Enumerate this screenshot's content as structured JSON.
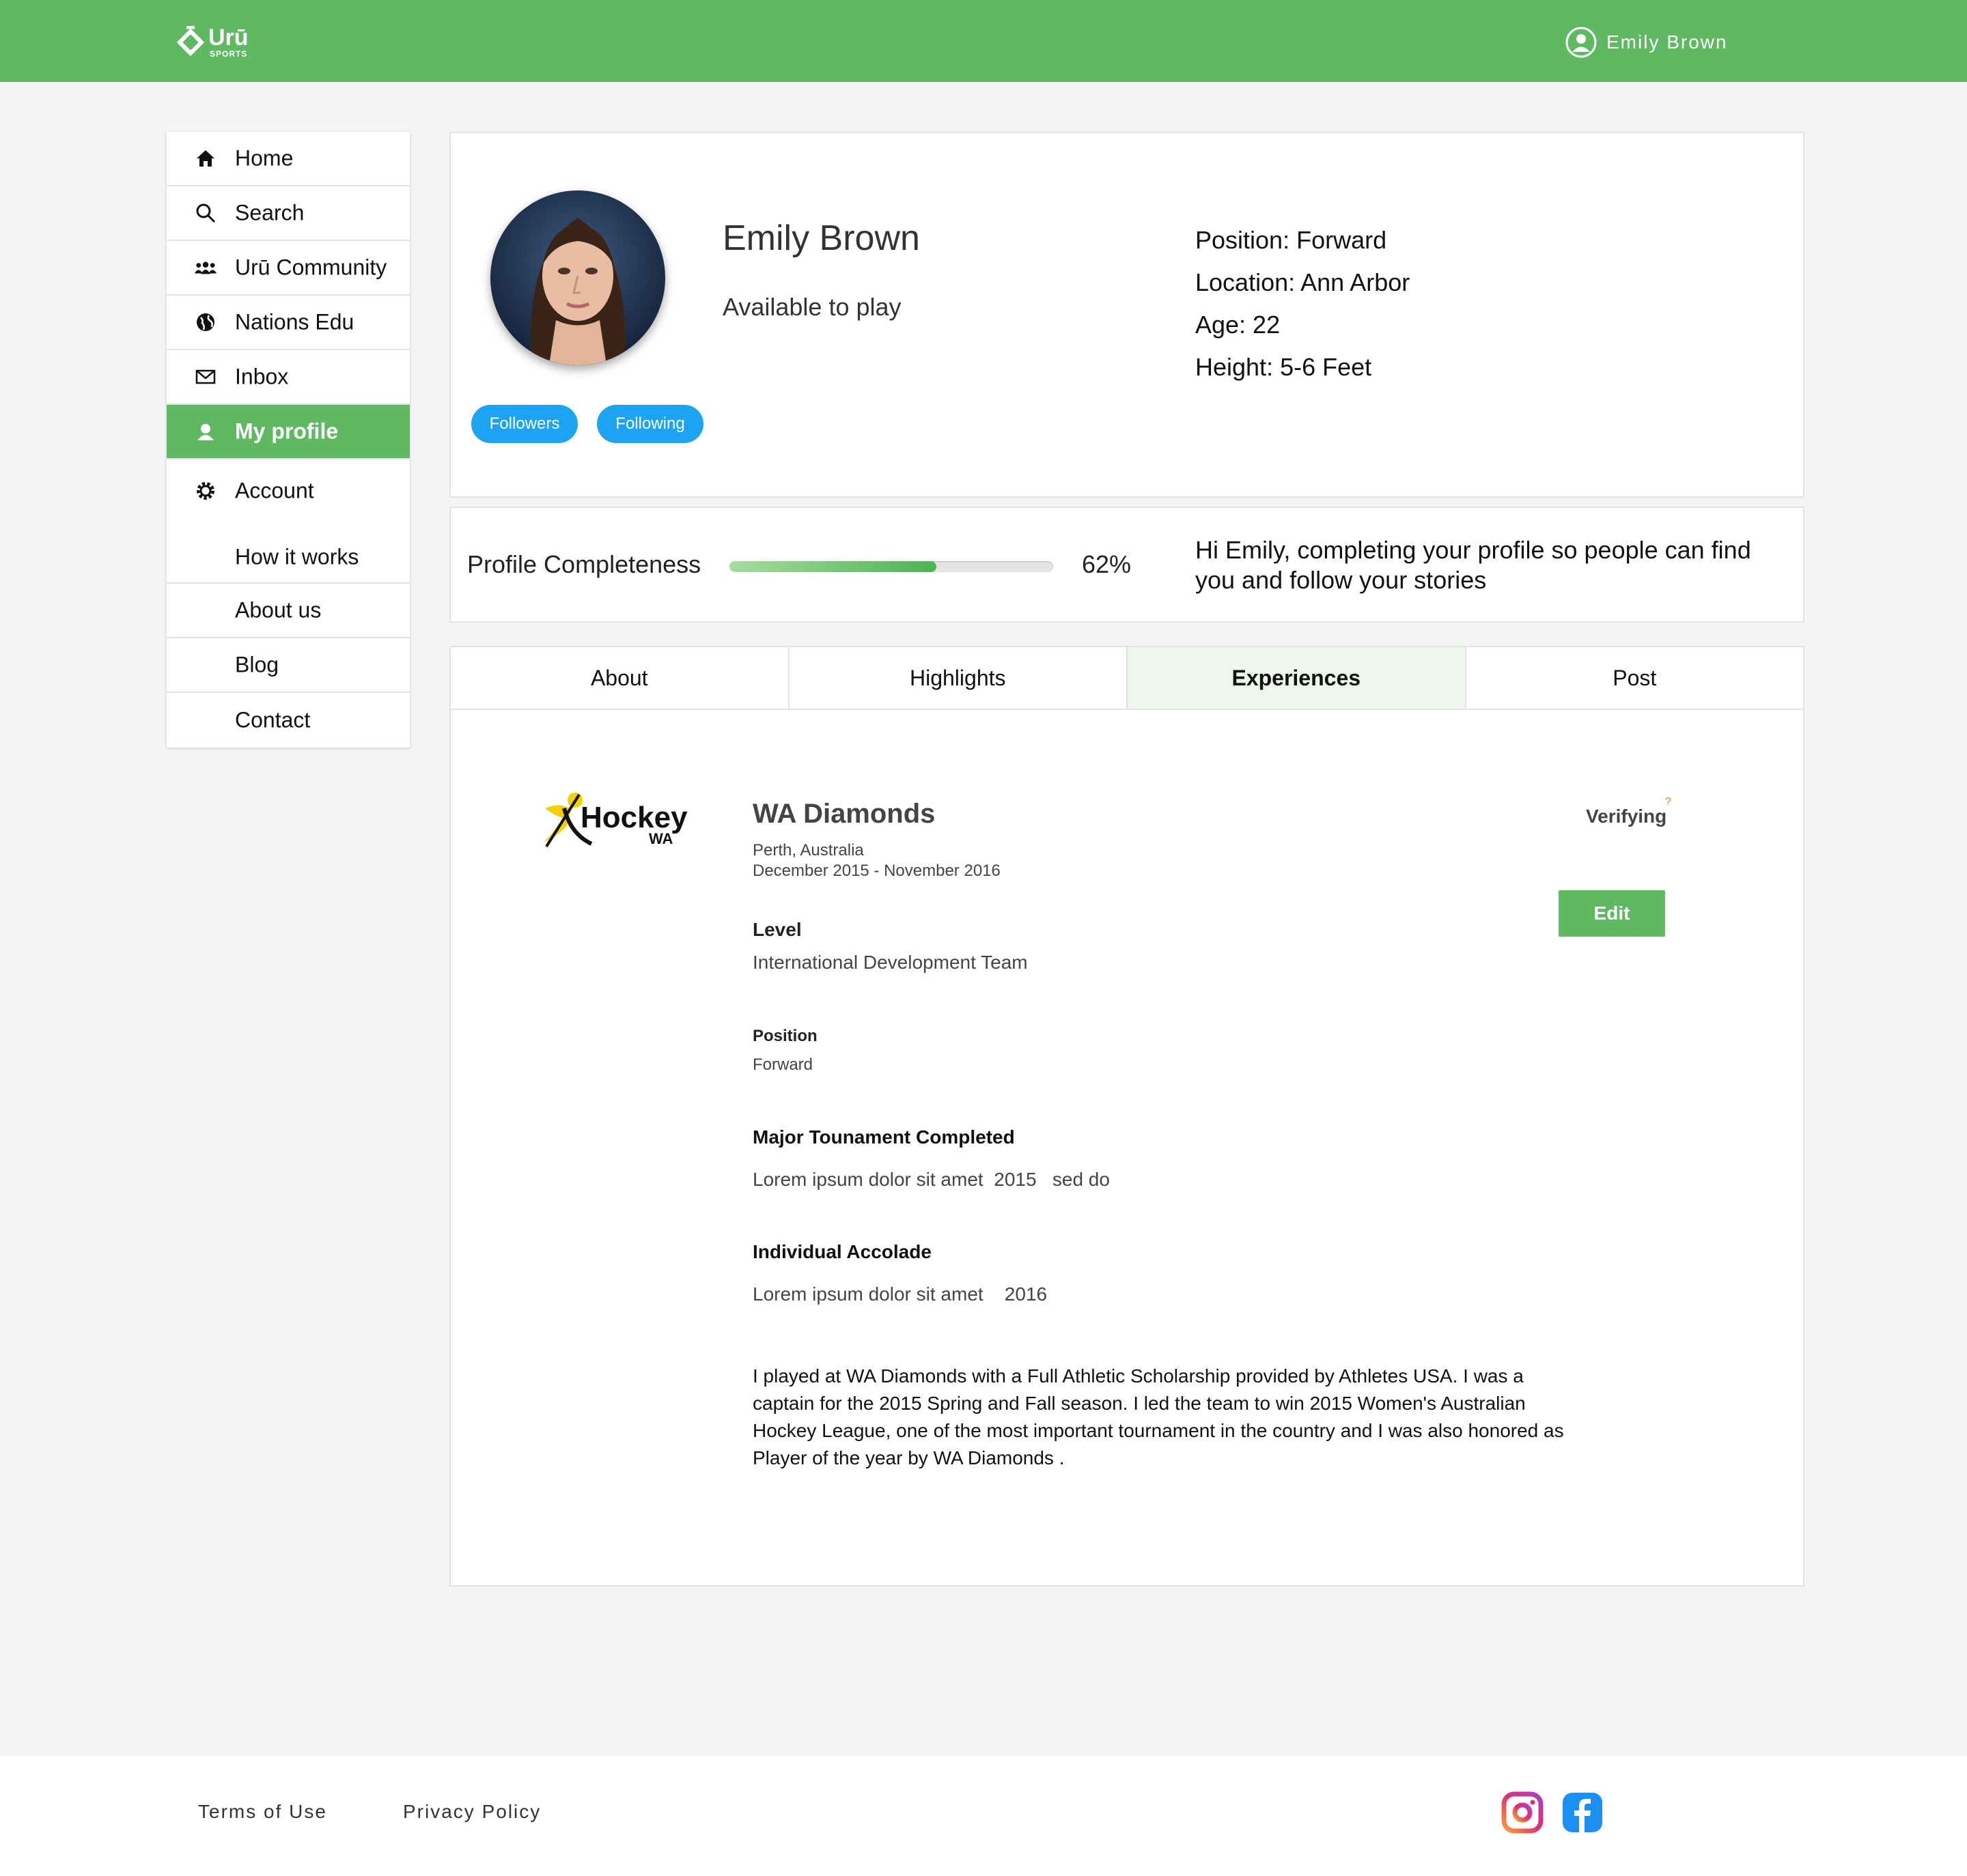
{
  "header": {
    "logo_text": "Urū",
    "logo_sub": "SPORTS",
    "user_name": "Emily Brown"
  },
  "sidebar": {
    "items": [
      {
        "label": "Home",
        "icon": "home-icon"
      },
      {
        "label": "Search",
        "icon": "search-icon"
      },
      {
        "label": "Urū Community",
        "icon": "community-icon"
      },
      {
        "label": "Nations Edu",
        "icon": "globe-icon"
      },
      {
        "label": "Inbox",
        "icon": "mail-icon"
      },
      {
        "label": "My profile",
        "icon": "user-icon",
        "active": true
      },
      {
        "label": "Account",
        "icon": "gear-icon"
      },
      {
        "label": "How it works"
      },
      {
        "label": "About us"
      },
      {
        "label": "Blog"
      },
      {
        "label": "Contact"
      }
    ]
  },
  "profile": {
    "name": "Emily Brown",
    "status": "Available to play",
    "followers_label": "Followers",
    "following_label": "Following",
    "position": "Position: Forward",
    "location": "Location: Ann Arbor",
    "age": "Age: 22",
    "height": "Height: 5-6 Feet"
  },
  "completeness": {
    "label": "Profile Completeness",
    "percent_text": "62%",
    "bar_fraction": 0.64,
    "message": "Hi Emily, completing your profile so people can find you and follow your stories"
  },
  "tabs": [
    {
      "label": "About"
    },
    {
      "label": "Highlights"
    },
    {
      "label": "Experiences",
      "active": true
    },
    {
      "label": "Post"
    }
  ],
  "experience": {
    "logo_text": "Hockey",
    "logo_sub": "WA",
    "team": "WA Diamonds",
    "location": "Perth, Australia",
    "dates": "December 2015 - November 2016",
    "verify_status": "Verifying",
    "verify_mark": "?",
    "edit_label": "Edit",
    "level_label": "Level",
    "level_value": "International Development Team",
    "position_label": "Position",
    "position_value": "Forward",
    "tournament_label": "Major Tounament Completed",
    "tournament_value": "Lorem ipsum dolor sit amet  2015   sed do",
    "accolade_label": "Individual Accolade",
    "accolade_value": "Lorem ipsum dolor sit amet    2016",
    "description": "I played at WA Diamonds with a Full Athletic Scholarship provided by Athletes USA. I was a captain for the 2015 Spring and Fall season. I led the team to win 2015 Women's Australian Hockey League, one of the most important tournament in the country and I was also honored as Player of the year by WA Diamonds ."
  },
  "footer": {
    "terms": "Terms of Use",
    "privacy": "Privacy Policy",
    "social": [
      "instagram-icon",
      "facebook-icon"
    ]
  },
  "colors": {
    "brand_green": "#5fb862",
    "pill_blue": "#1ca4f2",
    "instagram": "#e1306c",
    "facebook": "#1877f2"
  }
}
